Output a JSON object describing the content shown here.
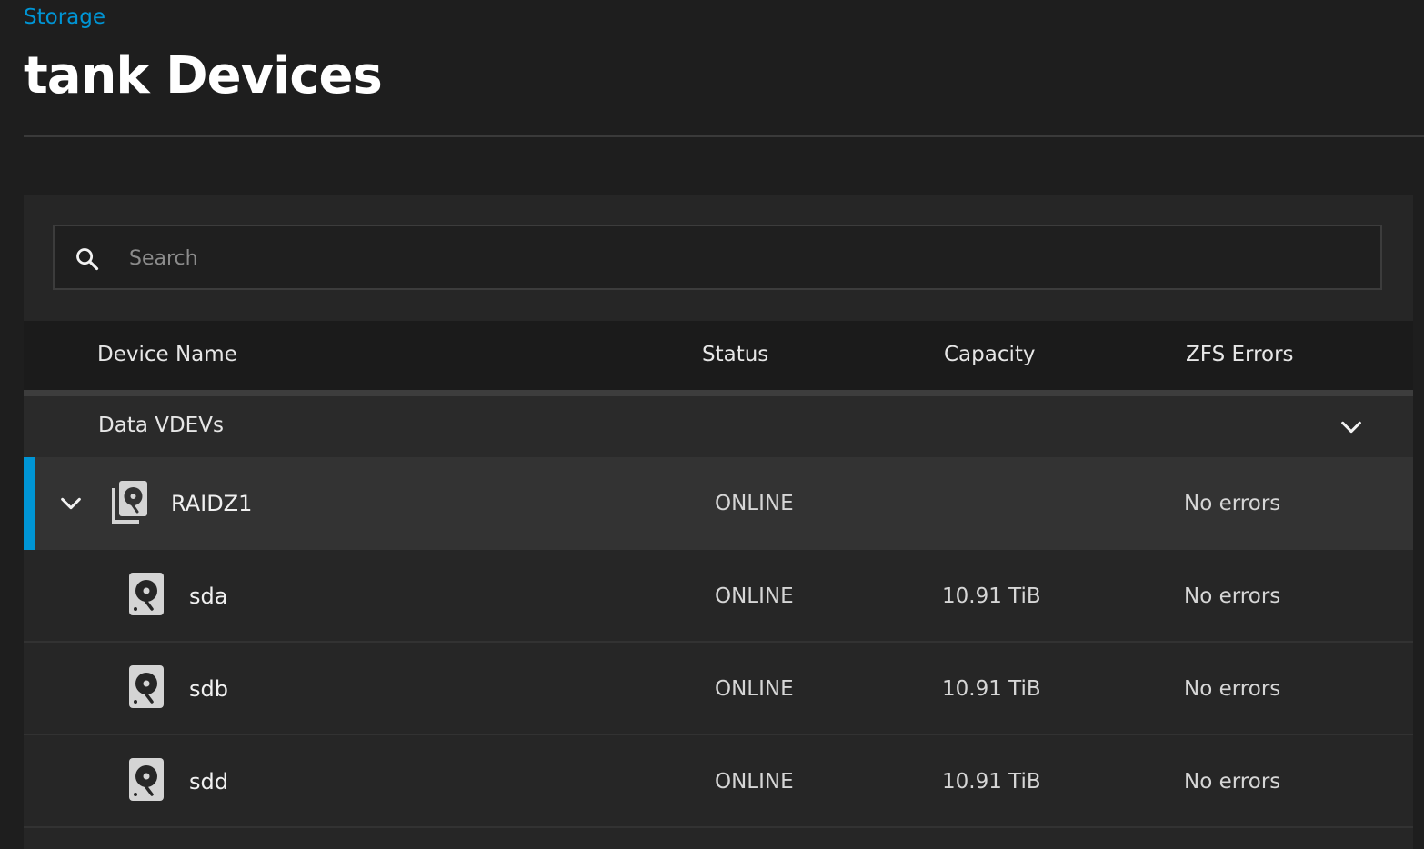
{
  "breadcrumb": "Storage",
  "title": "tank Devices",
  "search": {
    "placeholder": "Search",
    "value": ""
  },
  "columns": {
    "device_name": "Device Name",
    "status": "Status",
    "capacity": "Capacity",
    "zfs_errors": "ZFS Errors"
  },
  "group": {
    "label": "Data VDEVs",
    "expanded": true
  },
  "vdev": {
    "name": "RAIDZ1",
    "status": "ONLINE",
    "capacity": "",
    "errors": "No errors",
    "icon": "disk-stack-icon",
    "selected": true,
    "expanded": true
  },
  "disks": [
    {
      "name": "sda",
      "status": "ONLINE",
      "capacity": "10.91 TiB",
      "errors": "No errors",
      "icon": "hard-disk-icon"
    },
    {
      "name": "sdb",
      "status": "ONLINE",
      "capacity": "10.91 TiB",
      "errors": "No errors",
      "icon": "hard-disk-icon"
    },
    {
      "name": "sdd",
      "status": "ONLINE",
      "capacity": "10.91 TiB",
      "errors": "No errors",
      "icon": "hard-disk-icon"
    }
  ],
  "colors": {
    "accent": "#0095d5",
    "background": "#1e1e1e",
    "panel": "#262626",
    "selected_row": "#333333"
  }
}
